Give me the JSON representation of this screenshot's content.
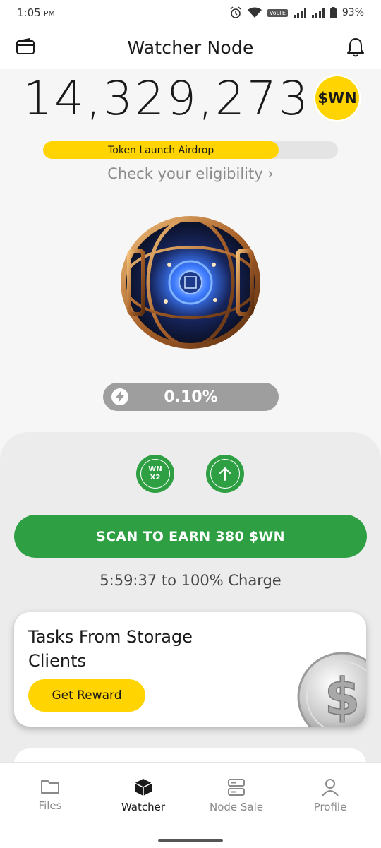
{
  "status_bar": {
    "time": "1:05",
    "ampm": "PM",
    "volte": "VoLTE",
    "battery": "93%"
  },
  "header": {
    "title": "Watcher Node"
  },
  "balance": {
    "amount": "14,329,273",
    "token_badge": "$WN"
  },
  "airdrop": {
    "label": "Token Launch Airdrop",
    "progress_fraction": 0.8,
    "eligibility_link": "Check your eligibility ›"
  },
  "charge": {
    "percent": "0.10%"
  },
  "actions": {
    "multiplier_line1": "WN",
    "multiplier_line2": "X2",
    "scan_button": "SCAN TO EARN 380 $WN",
    "charge_countdown": "5:59:37 to 100% Charge"
  },
  "task_card": {
    "title": "Tasks From Storage Clients",
    "button": "Get Reward"
  },
  "bottom_nav": {
    "items": [
      {
        "label": "Files",
        "icon": "folder-icon"
      },
      {
        "label": "Watcher",
        "icon": "cube-icon",
        "active": true
      },
      {
        "label": "Node Sale",
        "icon": "server-icon"
      },
      {
        "label": "Profile",
        "icon": "person-icon"
      }
    ]
  },
  "colors": {
    "accent_yellow": "#ffd400",
    "accent_green": "#2ea043"
  }
}
